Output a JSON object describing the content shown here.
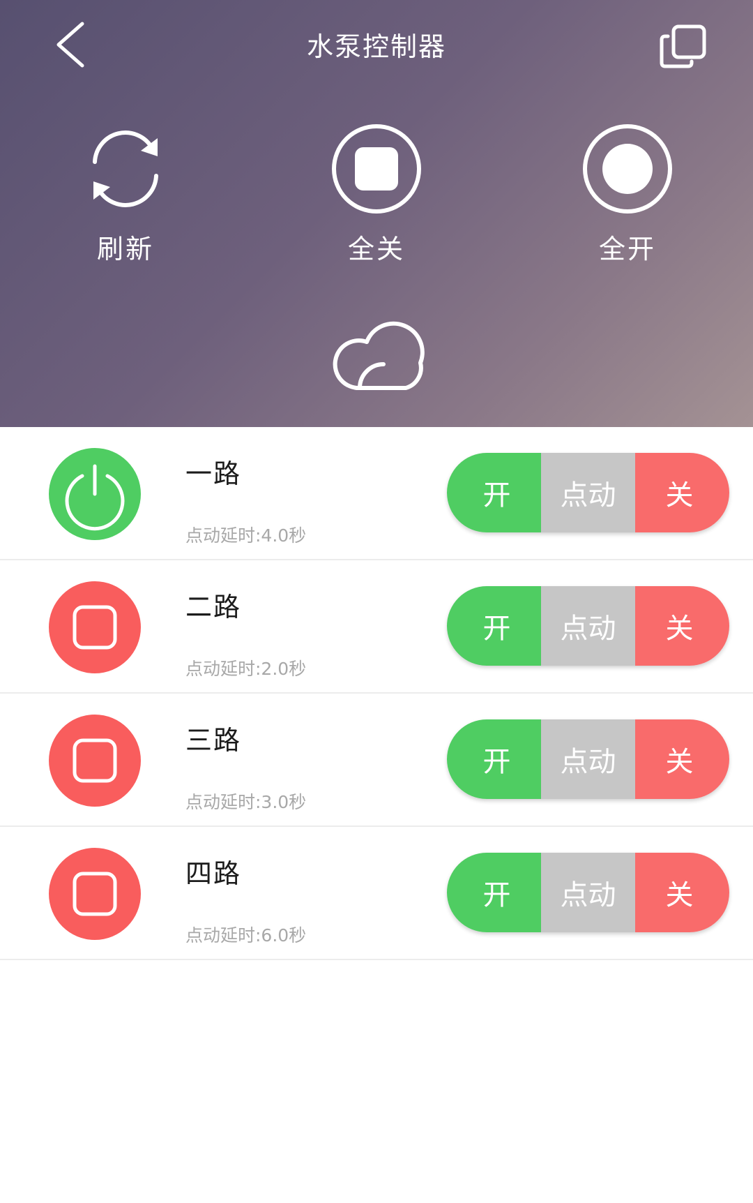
{
  "header": {
    "title": "水泵控制器",
    "actions": [
      {
        "label": "刷新",
        "icon": "refresh-icon"
      },
      {
        "label": "全关",
        "icon": "stop-circle-icon"
      },
      {
        "label": "全开",
        "icon": "record-circle-icon"
      }
    ],
    "cloud_icon": "cloud-icon"
  },
  "channels": [
    {
      "name": "一路",
      "delay": "点动延时:4.0秒",
      "state": "on",
      "buttons": {
        "on": "开",
        "jog": "点动",
        "off": "关"
      }
    },
    {
      "name": "二路",
      "delay": "点动延时:2.0秒",
      "state": "off",
      "buttons": {
        "on": "开",
        "jog": "点动",
        "off": "关"
      }
    },
    {
      "name": "三路",
      "delay": "点动延时:3.0秒",
      "state": "off",
      "buttons": {
        "on": "开",
        "jog": "点动",
        "off": "关"
      }
    },
    {
      "name": "四路",
      "delay": "点动延时:6.0秒",
      "state": "off",
      "buttons": {
        "on": "开",
        "jog": "点动",
        "off": "关"
      }
    }
  ],
  "colors": {
    "on": "#4fcd62",
    "off": "#f95d5d",
    "jog": "#c6c6c6"
  }
}
